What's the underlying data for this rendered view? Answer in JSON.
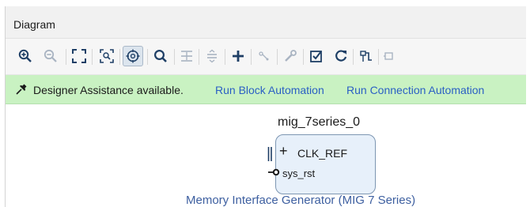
{
  "panel": {
    "title": "Diagram"
  },
  "toolbar": {
    "buttons": [
      {
        "name": "zoom-in",
        "icon": "zoom-in-icon",
        "enabled": true
      },
      {
        "name": "zoom-out",
        "icon": "zoom-out-icon",
        "enabled": false
      },
      {
        "name": "zoom-fit",
        "icon": "zoom-fit-icon",
        "enabled": true
      },
      {
        "name": "zoom-area",
        "icon": "zoom-area-icon",
        "enabled": true
      },
      {
        "name": "auto-fit-selection",
        "icon": "auto-fit-selection-icon",
        "enabled": true,
        "selected": true
      },
      {
        "name": "search",
        "icon": "search-icon",
        "enabled": true
      },
      {
        "name": "collapse-all",
        "icon": "collapse-all-icon",
        "enabled": false
      },
      {
        "name": "expand-all",
        "icon": "expand-all-icon",
        "enabled": false
      },
      {
        "name": "add-ip",
        "icon": "add-icon",
        "enabled": true
      },
      {
        "name": "make-connection",
        "icon": "connection-icon",
        "enabled": false
      },
      {
        "name": "customize-block",
        "icon": "wrench-icon",
        "enabled": false
      },
      {
        "name": "validate-design",
        "icon": "checkbox-icon",
        "enabled": true
      },
      {
        "name": "regenerate-layout",
        "icon": "refresh-icon",
        "enabled": true
      },
      {
        "name": "optimize-routing",
        "icon": "routing-icon",
        "enabled": true
      },
      {
        "name": "more",
        "icon": "partial-icon",
        "enabled": false
      }
    ]
  },
  "assistance": {
    "icon": "pin-icon",
    "message": "Designer Assistance available.",
    "links": {
      "block_automation": "Run Block Automation",
      "connection_automation": "Run Connection Automation"
    }
  },
  "block": {
    "instance_name": "mig_7series_0",
    "pins": {
      "clk_ref": "CLK_REF",
      "sys_rst": "sys_rst"
    },
    "caption": "Memory Interface Generator (MIG 7 Series)"
  },
  "colors": {
    "toolbar_icon": "#1e3f66",
    "assist_bg": "#c9f2c2",
    "link": "#2a5fc4",
    "block_fill": "#e7f0fa",
    "caption": "#3d5fa0"
  }
}
